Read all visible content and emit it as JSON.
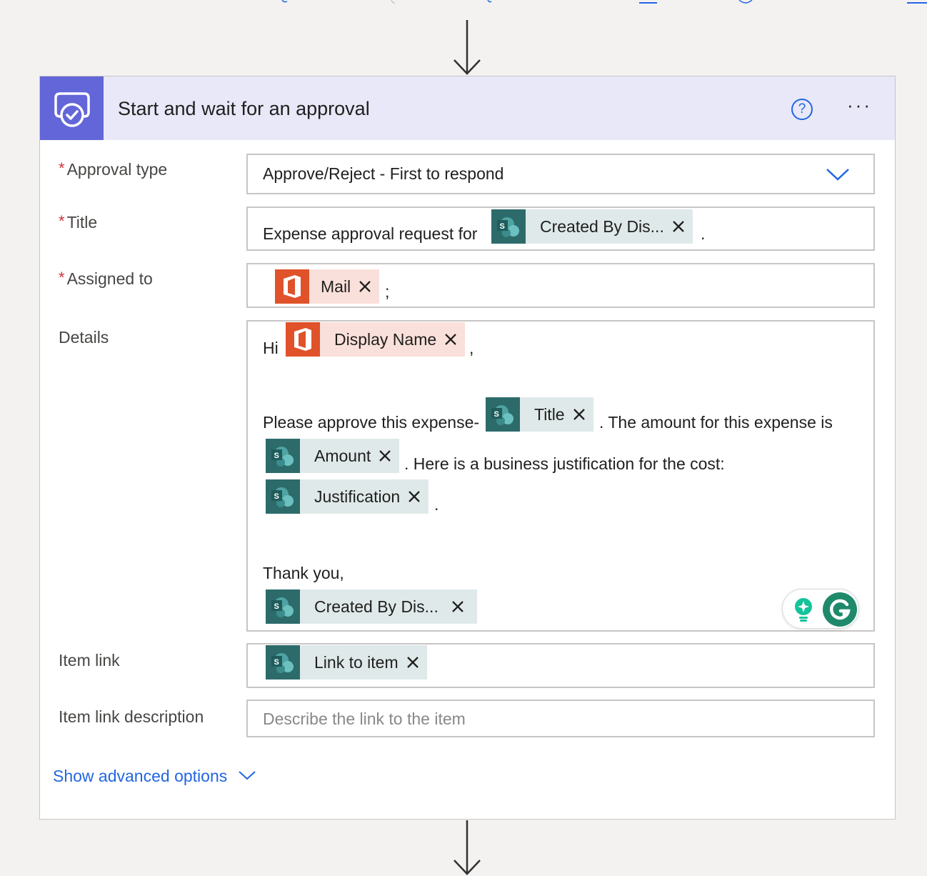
{
  "action": {
    "title": "Start and wait for an approval",
    "icon": "approval-icon",
    "help_symbol": "?",
    "more_symbol": "···"
  },
  "fields": {
    "approval_type": {
      "label": "Approval type",
      "required_mark": "*",
      "value": "Approve/Reject - First to respond"
    },
    "title": {
      "label": "Title",
      "required_mark": "*",
      "prefix": "Expense approval request for",
      "token": "Created By Dis...",
      "suffix": "."
    },
    "assigned_to": {
      "label": "Assigned to",
      "required_mark": "*",
      "token": "Mail",
      "suffix": ";"
    },
    "details": {
      "label": "Details",
      "greeting": "Hi",
      "greeting_token": "Display Name",
      "greeting_suffix": ",",
      "line1_text": "Please approve this expense-",
      "line1_token": "Title",
      "line1_suffix": ". The amount for this expense is",
      "line2_token": "Amount",
      "line2_suffix": ". Here is a business justification for the cost:",
      "line3_token": "Justification",
      "line3_suffix": ".",
      "closing": "Thank you,",
      "closing_token": "Created By Dis..."
    },
    "item_link": {
      "label": "Item link",
      "token": "Link to item"
    },
    "item_link_description": {
      "label": "Item link description",
      "placeholder": "Describe the link to the item"
    }
  },
  "advanced_options_label": "Show advanced options",
  "colors": {
    "header_bg": "#e8e8f8",
    "header_icon_bg": "#6366d8",
    "accent_blue": "#2266e3",
    "required_red": "#d13438",
    "sharepoint_token_bg": "#dfe9e9",
    "sharepoint_icon_bg": "#2d6b6b",
    "office_token_bg": "#fae0da",
    "office_icon_bg": "#e0522a"
  }
}
